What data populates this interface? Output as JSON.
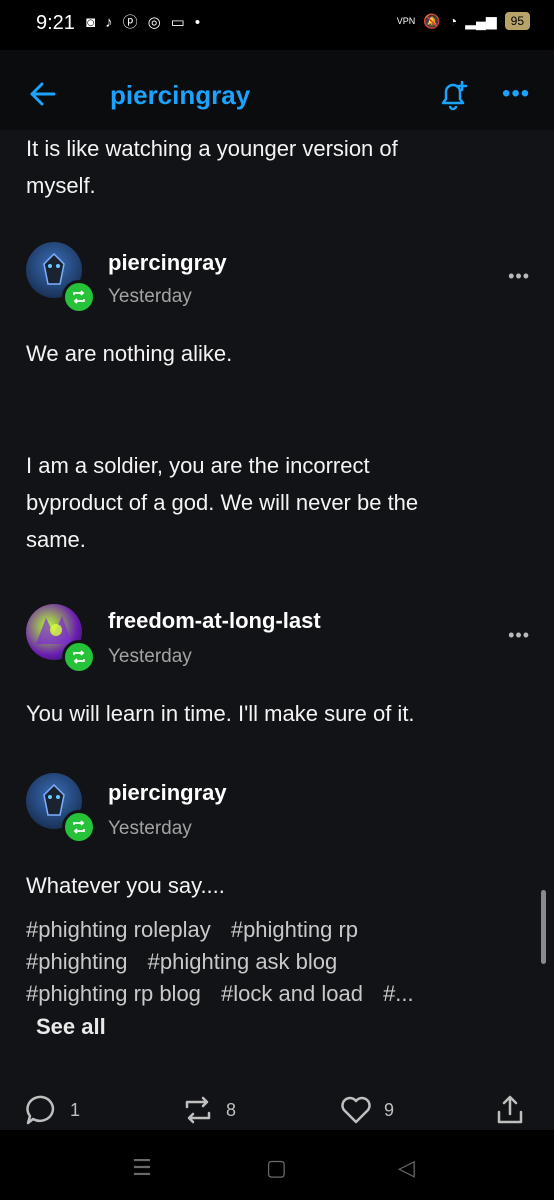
{
  "status": {
    "time": "9:21",
    "vpn": "VPN",
    "battery": "95"
  },
  "header": {
    "blog_name": "piercingray"
  },
  "post": {
    "intro_text": [
      "It is like watching a younger version of",
      "myself."
    ],
    "entries": [
      {
        "username": "piercingray",
        "time": "Yesterday",
        "lines": [
          "We are nothing alike."
        ]
      },
      {
        "username": "piercingray",
        "time": "Yesterday",
        "lines": [
          "I am a soldier, you are the incorrect",
          "byproduct of a god. We will never be the",
          "same."
        ]
      },
      {
        "username": "freedom-at-long-last",
        "time": "Yesterday",
        "lines": [
          "You will learn in time. I'll make sure of it."
        ]
      },
      {
        "username": "piercingray",
        "time": "Yesterday",
        "lines": [
          "Whatever you say...."
        ]
      }
    ],
    "tags": [
      [
        "#phighting roleplay",
        "#phighting rp"
      ],
      [
        "#phighting",
        "#phighting ask blog"
      ],
      [
        "#phighting rp blog",
        "#lock and load",
        "#..."
      ]
    ],
    "see_all": "See all"
  },
  "actions": {
    "replies": "1",
    "reblogs": "8",
    "likes": "9"
  },
  "colors": {
    "accent": "#1aa3ff",
    "reblog_green": "#26c33a",
    "background": "#121317"
  }
}
